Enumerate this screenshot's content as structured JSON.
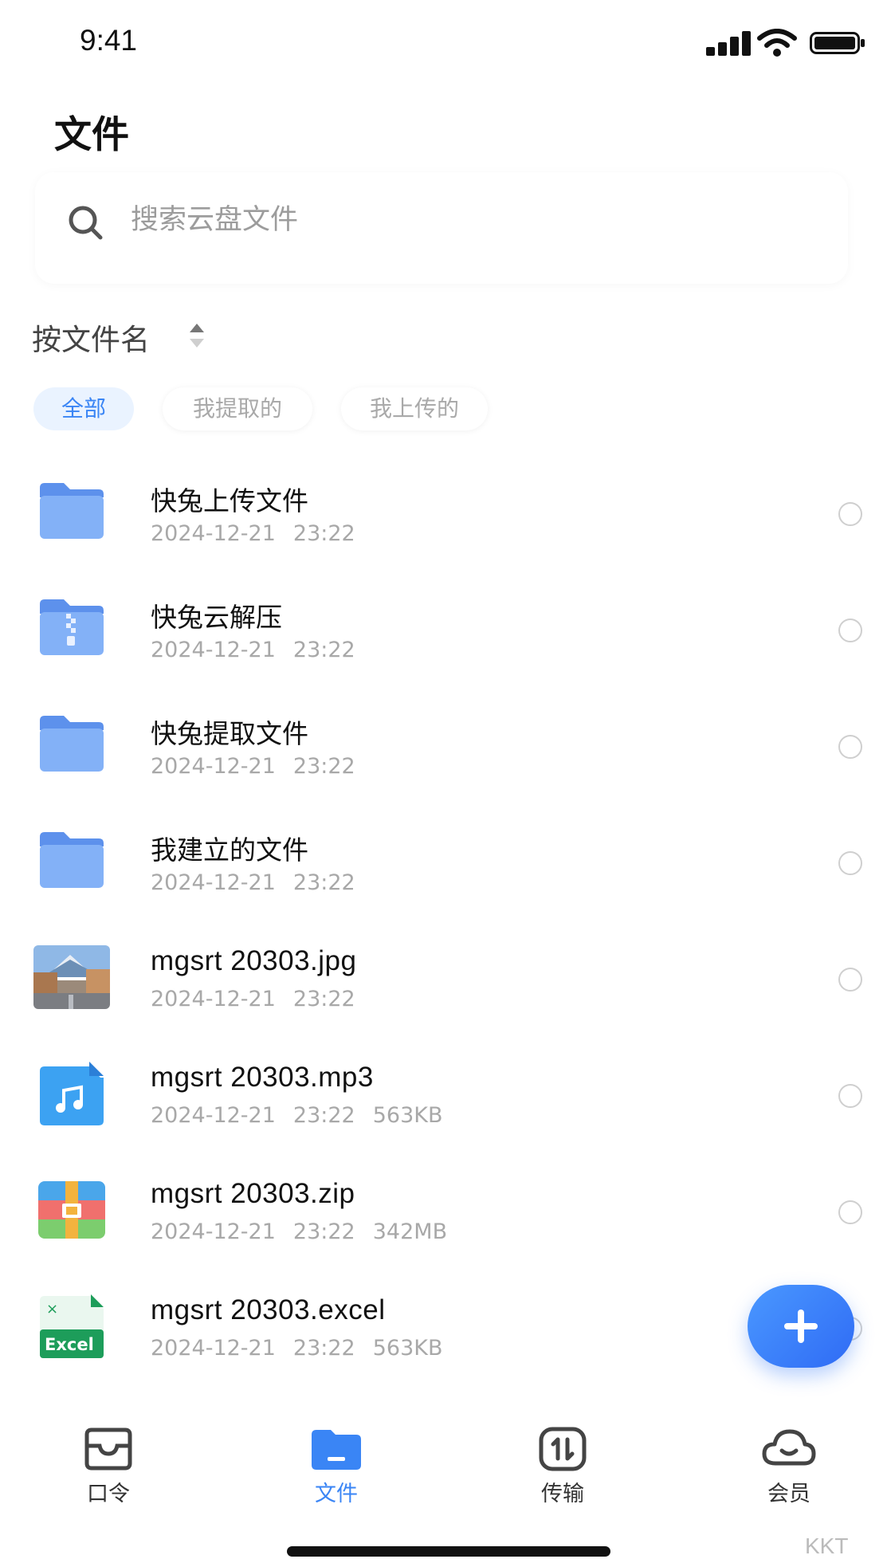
{
  "status_bar": {
    "time": "9:41"
  },
  "page_title": "文件",
  "search": {
    "placeholder": "搜索云盘文件"
  },
  "sort": {
    "label": "按文件名"
  },
  "filters": [
    {
      "label": "全部",
      "active": true
    },
    {
      "label": "我提取的",
      "active": false
    },
    {
      "label": "我上传的",
      "active": false
    }
  ],
  "files": [
    {
      "name": "快兔上传文件",
      "date": "2024-12-21",
      "time": "23:22",
      "size": "",
      "icon": "folder-icon"
    },
    {
      "name": "快兔云解压",
      "date": "2024-12-21",
      "time": "23:22",
      "size": "",
      "icon": "zip-folder-icon"
    },
    {
      "name": "快兔提取文件",
      "date": "2024-12-21",
      "time": "23:22",
      "size": "",
      "icon": "folder-icon"
    },
    {
      "name": "我建立的文件",
      "date": "2024-12-21",
      "time": "23:22",
      "size": "",
      "icon": "folder-icon"
    },
    {
      "name": "mgsrt 20303.jpg",
      "date": "2024-12-21",
      "time": "23:22",
      "size": "",
      "icon": "image-thumbnail"
    },
    {
      "name": "mgsrt 20303.mp3",
      "date": "2024-12-21",
      "time": "23:22",
      "size": "563KB",
      "icon": "music-file-icon"
    },
    {
      "name": "mgsrt 20303.zip",
      "date": "2024-12-21",
      "time": "23:22",
      "size": "342MB",
      "icon": "archive-file-icon"
    },
    {
      "name": "mgsrt 20303.excel",
      "date": "2024-12-21",
      "time": "23:22",
      "size": "563KB",
      "icon": "excel-file-icon"
    }
  ],
  "excel_icon_text": "Excel",
  "nav": [
    {
      "label": "口令",
      "icon": "inbox-icon",
      "active": false
    },
    {
      "label": "文件",
      "icon": "folder-icon",
      "active": true
    },
    {
      "label": "传输",
      "icon": "transfer-icon",
      "active": false
    },
    {
      "label": "会员",
      "icon": "cloud-icon",
      "active": false
    }
  ],
  "watermark": "KKT",
  "colors": {
    "accent": "#3a85f5",
    "folder": "#79a9f3",
    "muted": "#a8a8a8"
  }
}
